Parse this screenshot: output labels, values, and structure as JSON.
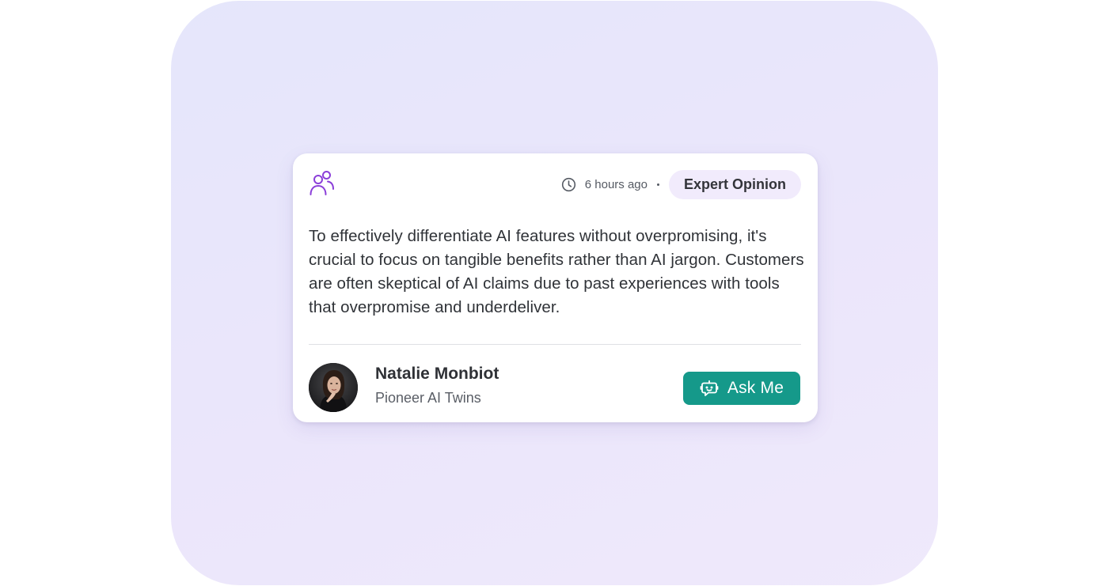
{
  "card": {
    "category_icon": "people-icon",
    "timestamp_icon": "clock-icon",
    "timestamp": "6 hours ago",
    "badge": "Expert Opinion",
    "quote": "To effectively differentiate AI features without overpromising, it's crucial to focus on tangible benefits rather than AI jargon. Customers are often skeptical of AI claims due to past experiences with tools that overpromise and underdeliver.",
    "author": {
      "name": "Natalie Monbiot",
      "role": "Pioneer AI Twins",
      "avatar_icon": "avatar-photo"
    },
    "cta": {
      "label": "Ask Me",
      "icon": "chatbot-icon"
    }
  },
  "colors": {
    "accent_purple": "#8b3fd9",
    "badge_bg": "#f1ebfc",
    "button_bg": "#15998a",
    "text_primary": "#303338",
    "backdrop": "#e8e6fb"
  }
}
